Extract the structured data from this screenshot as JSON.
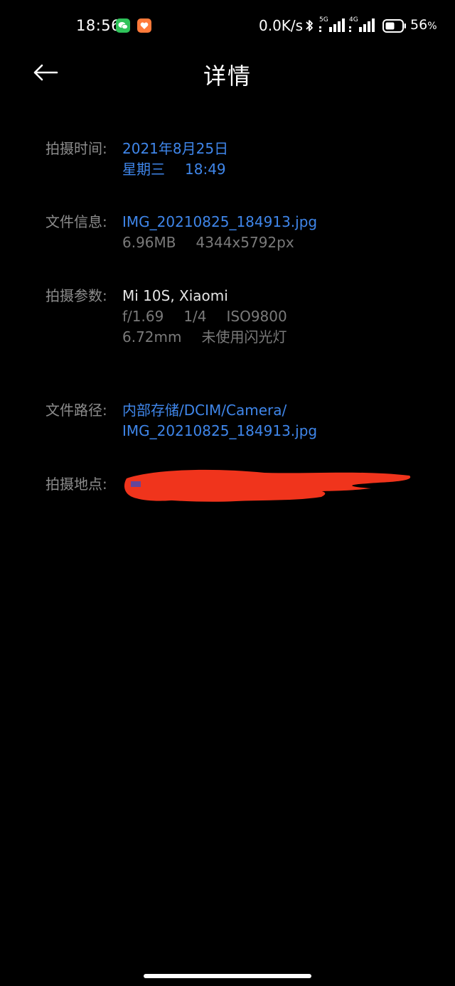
{
  "status_bar": {
    "time": "18:56",
    "net_speed": "0.0K/s",
    "sim1_label": "5G",
    "sim2_label": "4G",
    "battery_number": "56",
    "battery_unit": "%"
  },
  "header": {
    "title": "详情"
  },
  "details": {
    "capture_time": {
      "label": "拍摄时间:",
      "date": "2021年8月25日",
      "weekday": "星期三",
      "time": "18:49"
    },
    "file_info": {
      "label": "文件信息:",
      "filename": "IMG_20210825_184913.jpg",
      "size": "6.96MB",
      "resolution": "4344x5792px"
    },
    "capture_params": {
      "label": "拍摄参数:",
      "device": "Mi 10S, Xiaomi",
      "aperture": "f/1.69",
      "shutter": "1/4",
      "iso": "ISO9800",
      "focal_length": "6.72mm",
      "flash": "未使用闪光灯"
    },
    "file_path": {
      "label": "文件路径:",
      "path_line1": "内部存储/DCIM/Camera/",
      "path_line2": "IMG_20210825_184913.jpg"
    },
    "location": {
      "label": "拍摄地点:"
    }
  },
  "colors": {
    "background": "#000000",
    "link_blue": "#3f86ea",
    "label_gray": "#8c8c8c",
    "redaction_red": "#f0341c"
  }
}
